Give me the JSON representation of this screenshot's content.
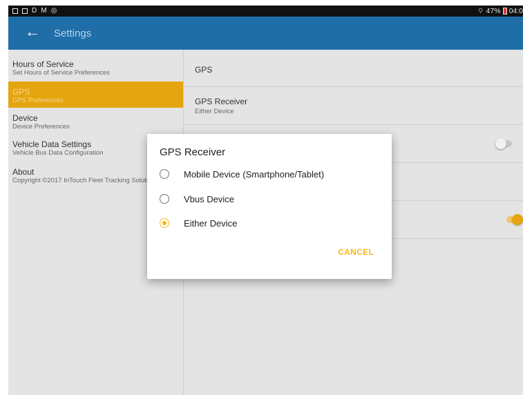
{
  "status_bar": {
    "left_icons": [
      "screenshot-icon",
      "mail-icon"
    ],
    "left_letters": [
      "D",
      "M"
    ],
    "right_text": "47%",
    "time": "04:0",
    "colors": {
      "battery": "#e53935"
    }
  },
  "app_bar": {
    "title": "Settings",
    "color": "#1f6ea8"
  },
  "sidebar": {
    "items": [
      {
        "title": "Hours of Service",
        "subtitle": "Set Hours of Service Preferences"
      },
      {
        "title": "GPS",
        "subtitle": "GPS Preferences",
        "active": true
      },
      {
        "title": "Device",
        "subtitle": "Device Preferences"
      },
      {
        "title": "Vehicle Data Settings",
        "subtitle": "Vehicle Bus Data Configuration"
      },
      {
        "title": "About",
        "subtitle": "Copyright ©2017 InTouch Fleet Tracking Solutions"
      }
    ],
    "active_color": "#e5a50f"
  },
  "main": {
    "header": "GPS",
    "rows": [
      {
        "title": "GPS Receiver",
        "subtitle": "Either Device"
      }
    ],
    "toggles": [
      {
        "state": "off"
      },
      {
        "state": "on"
      }
    ]
  },
  "dialog": {
    "title": "GPS Receiver",
    "options": [
      {
        "label": "Mobile Device (Smartphone/Tablet)",
        "selected": false
      },
      {
        "label": "Vbus Device",
        "selected": false
      },
      {
        "label": "Either Device",
        "selected": true
      }
    ],
    "cancel_label": "CANCEL",
    "accent": "#fbb817"
  }
}
